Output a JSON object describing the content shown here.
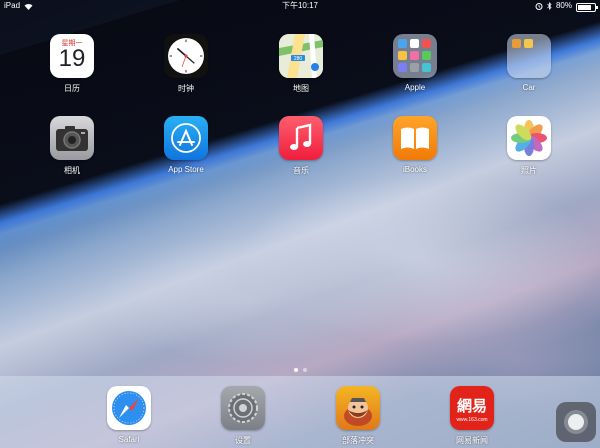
{
  "status": {
    "device": "iPad",
    "time": "下午10:17",
    "battery": "80%",
    "battery_level": 0.8
  },
  "home_apps": [
    {
      "label": "日历",
      "icon": "calendar-icon",
      "weekday": "星期一",
      "date": "19"
    },
    {
      "label": "时钟",
      "icon": "clock-icon"
    },
    {
      "label": "地图",
      "icon": "maps-icon",
      "badge_text": "280"
    },
    {
      "label": "Apple",
      "icon": "folder-icon"
    },
    {
      "label": "Car",
      "icon": "folder-icon"
    },
    {
      "label": "相机",
      "icon": "camera-icon"
    },
    {
      "label": "App Store",
      "icon": "app-store-icon"
    },
    {
      "label": "音乐",
      "icon": "music-icon"
    },
    {
      "label": "iBooks",
      "icon": "ibooks-icon"
    },
    {
      "label": "照片",
      "icon": "photos-icon"
    }
  ],
  "dock_apps": [
    {
      "label": "Safari",
      "icon": "safari-icon"
    },
    {
      "label": "设置",
      "icon": "settings-icon"
    },
    {
      "label": "部落冲突",
      "icon": "clash-of-clans-icon"
    },
    {
      "label": "网易新闻",
      "icon": "netease-news-icon",
      "logo_text": "網易",
      "site_text": "www.163.com"
    }
  ],
  "page_indicator": {
    "pages": 2,
    "current": 1
  }
}
